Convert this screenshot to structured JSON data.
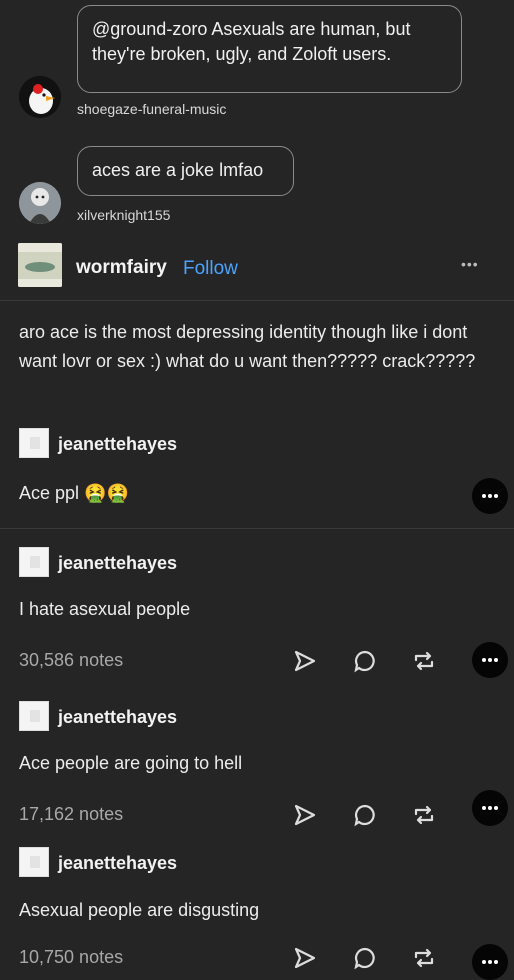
{
  "replies": [
    {
      "text": "@ground-zoro Asexuals are human, but they're broken, ugly, and Zoloft users.",
      "username": "shoegaze-funeral-music"
    },
    {
      "text": "aces are a joke lmfao",
      "username": "xilverknight155"
    }
  ],
  "header": {
    "username": "wormfairy",
    "follow_label": "Follow",
    "more_label": "•••"
  },
  "post": {
    "text": "aro ace is the most depressing identity though like i dont want lovr or sex :)  what do u want then????? crack?????"
  },
  "reblogs": [
    {
      "username": "jeanettehayes",
      "text": "Ace ppl 🤮🤮"
    },
    {
      "username": "jeanettehayes",
      "text": "I hate asexual people",
      "notes": "30,586 notes"
    },
    {
      "username": "jeanettehayes",
      "text": "Ace people are going to hell",
      "notes": "17,162 notes"
    },
    {
      "username": "jeanettehayes",
      "text": "Asexual people are disgusting",
      "notes": "10,750 notes"
    }
  ],
  "icons": [
    "share-icon",
    "reply-icon",
    "reblog-icon",
    "more-icon"
  ]
}
